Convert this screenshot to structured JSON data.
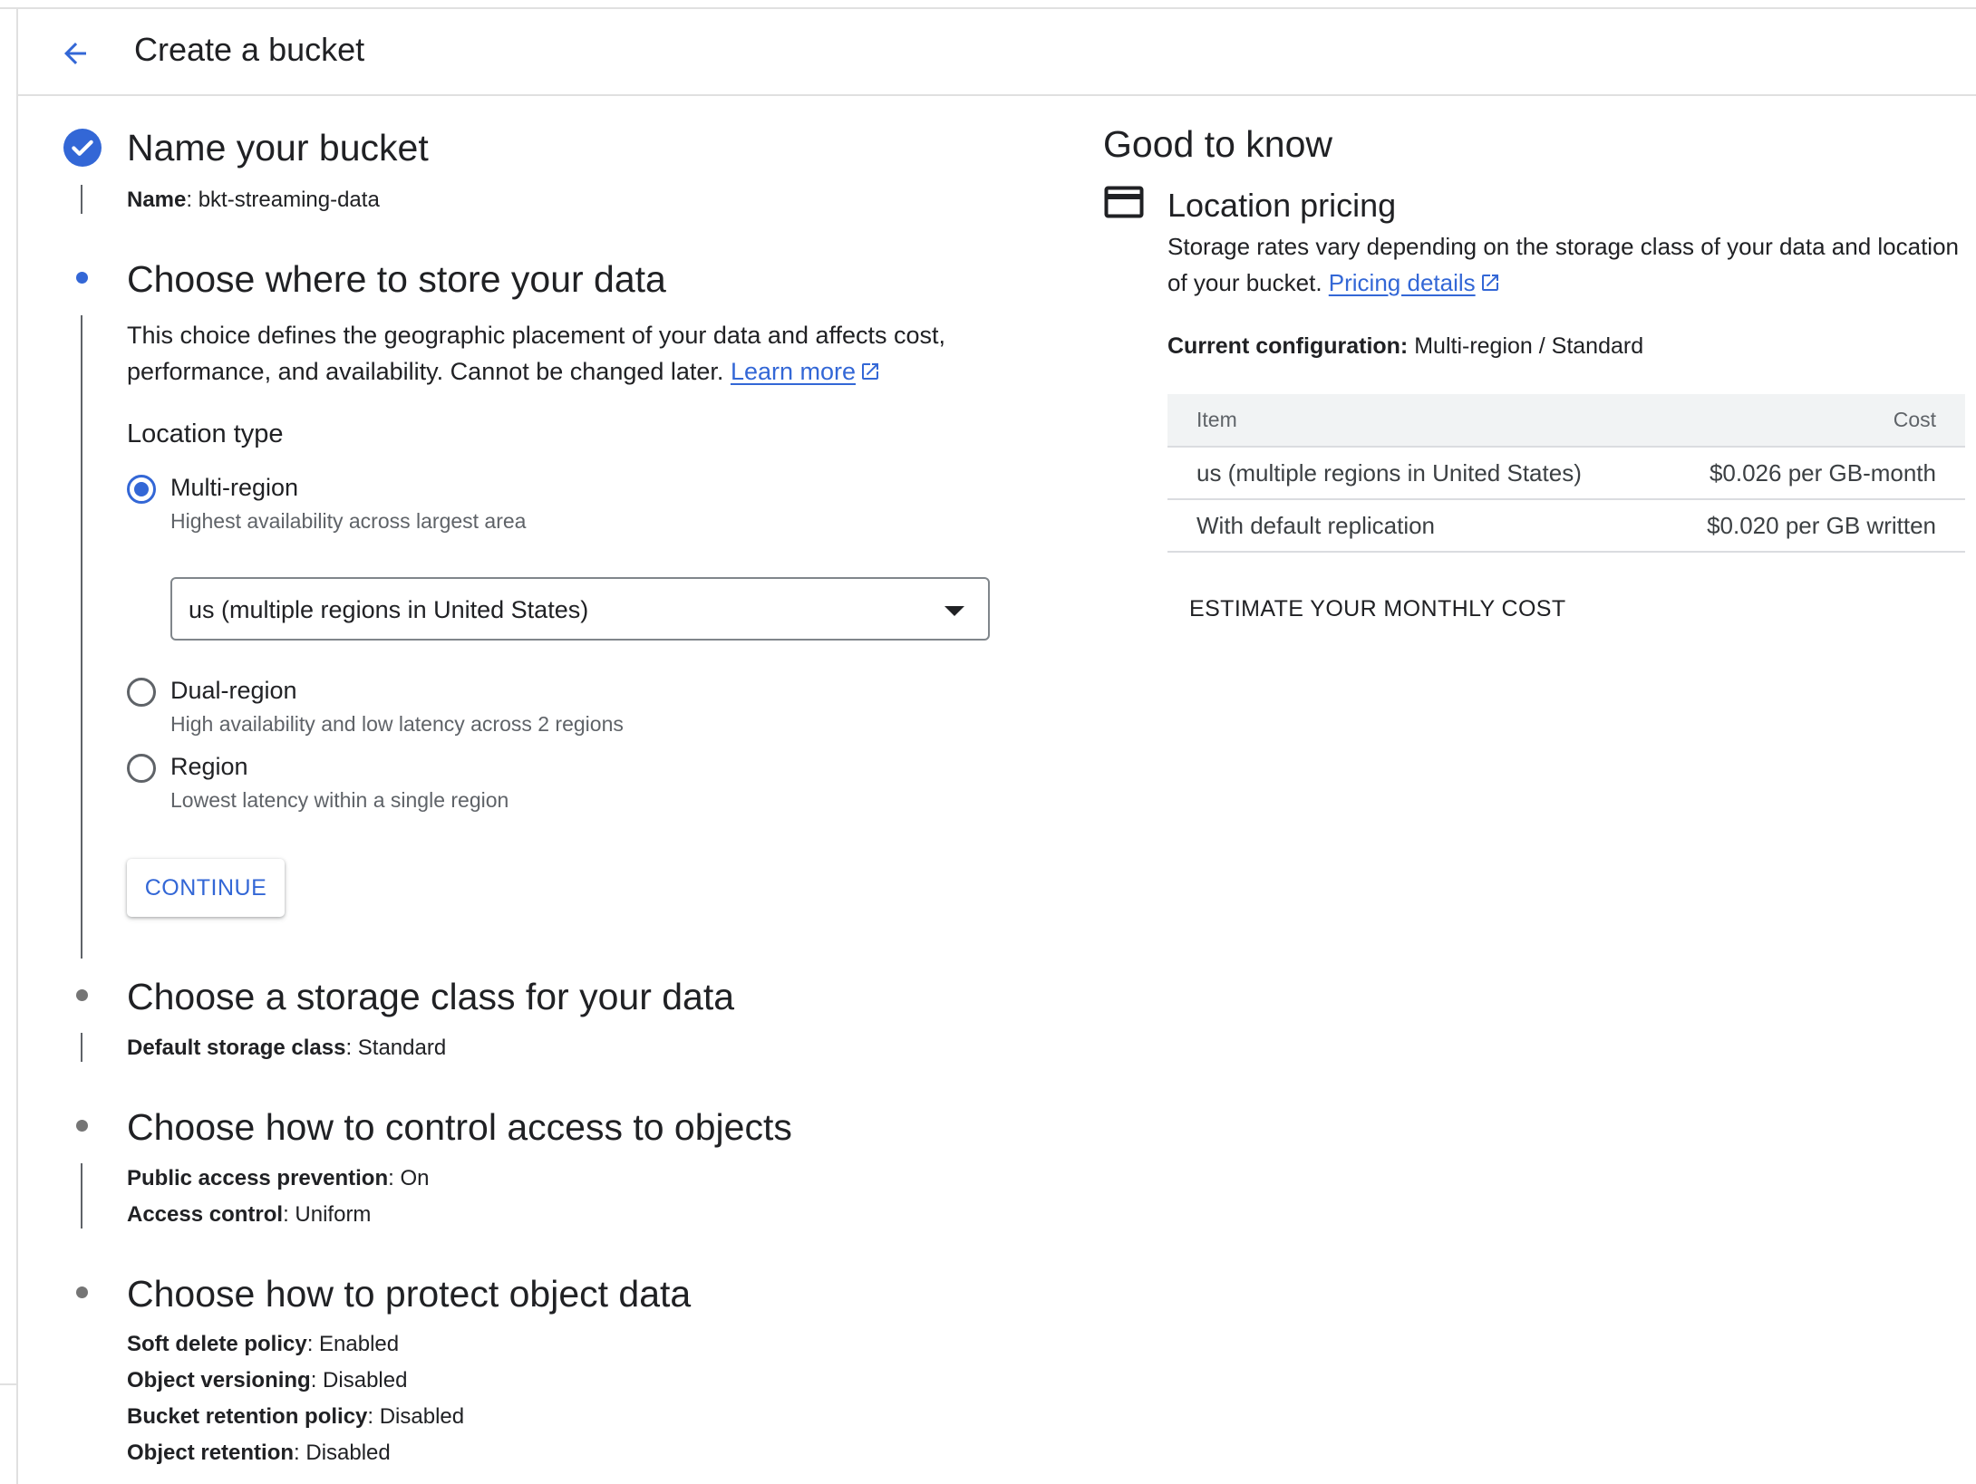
{
  "header": {
    "title": "Create a bucket",
    "back_icon": "arrow-back-icon"
  },
  "steps": {
    "name": {
      "title": "Name your bucket",
      "status": "complete",
      "summary_label": "Name",
      "summary_value": ": bkt-streaming-data"
    },
    "location": {
      "title": "Choose where to store your data",
      "description": "This choice defines the geographic placement of your data and affects cost, performance, and availability. Cannot be changed later.",
      "learn_more": "Learn more",
      "location_type_label": "Location type",
      "options": [
        {
          "label": "Multi-region",
          "sub": "Highest availability across largest area",
          "selected": true
        },
        {
          "label": "Dual-region",
          "sub": "High availability and low latency across 2 regions",
          "selected": false
        },
        {
          "label": "Region",
          "sub": "Lowest latency within a single region",
          "selected": false
        }
      ],
      "select_value": "us (multiple regions in United States)",
      "continue_label": "CONTINUE"
    },
    "storage_class": {
      "title": "Choose a storage class for your data",
      "label": "Default storage class",
      "value": ": Standard"
    },
    "access": {
      "title": "Choose how to control access to objects",
      "rows": [
        {
          "label": "Public access prevention",
          "value": ": On"
        },
        {
          "label": "Access control",
          "value": ": Uniform"
        }
      ]
    },
    "protect": {
      "title": "Choose how to protect object data",
      "rows": [
        {
          "label": "Soft delete policy",
          "value": ": Enabled"
        },
        {
          "label": "Object versioning",
          "value": ": Disabled"
        },
        {
          "label": "Bucket retention policy",
          "value": ": Disabled"
        },
        {
          "label": "Object retention",
          "value": ": Disabled"
        }
      ]
    }
  },
  "good_to_know": {
    "title": "Good to know",
    "location_pricing": {
      "icon": "credit-card-icon",
      "title": "Location pricing",
      "description": "Storage rates vary depending on the storage class of your data and location of your bucket.",
      "pricing_link": "Pricing details"
    },
    "current_config_label": "Current configuration:",
    "current_config_value": " Multi-region / Standard",
    "table": {
      "headers": [
        "Item",
        "Cost"
      ],
      "rows": [
        {
          "item": "us (multiple regions in United States)",
          "cost": "$0.026 per GB-month"
        },
        {
          "item": "With default replication",
          "cost": "$0.020 per GB written"
        }
      ]
    },
    "estimate_label": "ESTIMATE YOUR MONTHLY COST"
  },
  "colors": {
    "accent": "#3367d6",
    "text": "#202124",
    "secondary_text": "#5f6368",
    "divider": "#dadce0"
  }
}
